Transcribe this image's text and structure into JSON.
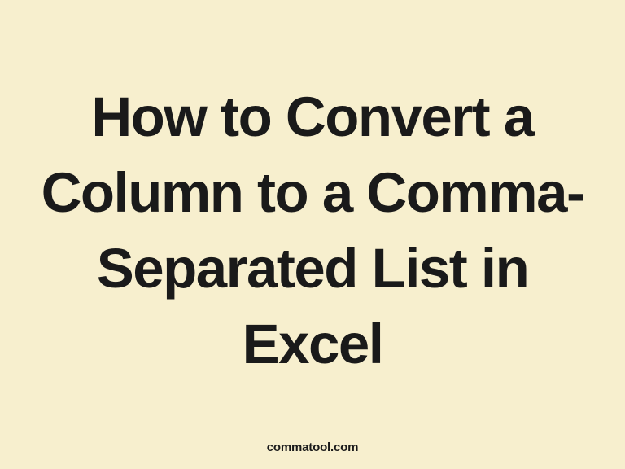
{
  "heading": {
    "text": "How to Convert a Column to a Comma-Separated List in Excel"
  },
  "footer": {
    "attribution": "commatool.com"
  }
}
